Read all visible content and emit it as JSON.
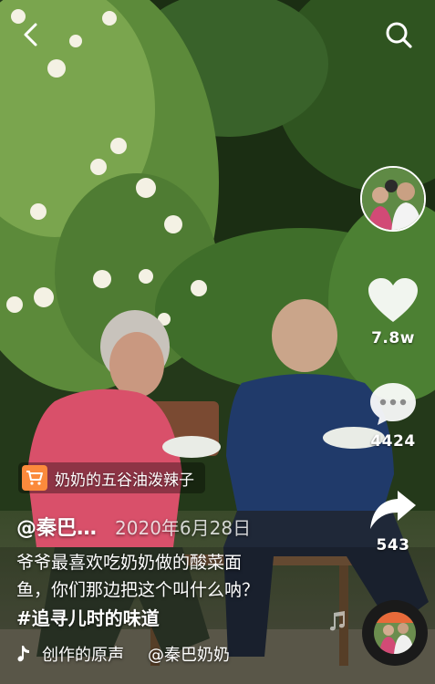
{
  "header": {
    "back_icon": "chevron-left-icon",
    "search_icon": "search-icon"
  },
  "rail": {
    "likes": "7.8w",
    "comments": "4424",
    "shares": "543"
  },
  "product": {
    "icon": "shopping-cart-icon",
    "label": "奶奶的五谷油泼辣子"
  },
  "post": {
    "author": "@秦巴…",
    "date": "2020年6月28日",
    "caption_line1": "爷爷最喜欢吃奶奶做的酸菜面",
    "caption_line2": "鱼，你们那边把这个叫什么呐？",
    "hashtag": "#追寻儿时的味道"
  },
  "music": {
    "icon": "tiktok-note-icon",
    "original": "创作的原声",
    "creator": "@秦巴奶奶"
  },
  "colors": {
    "accent": "#fb8a3c",
    "text": "#ffffff"
  }
}
